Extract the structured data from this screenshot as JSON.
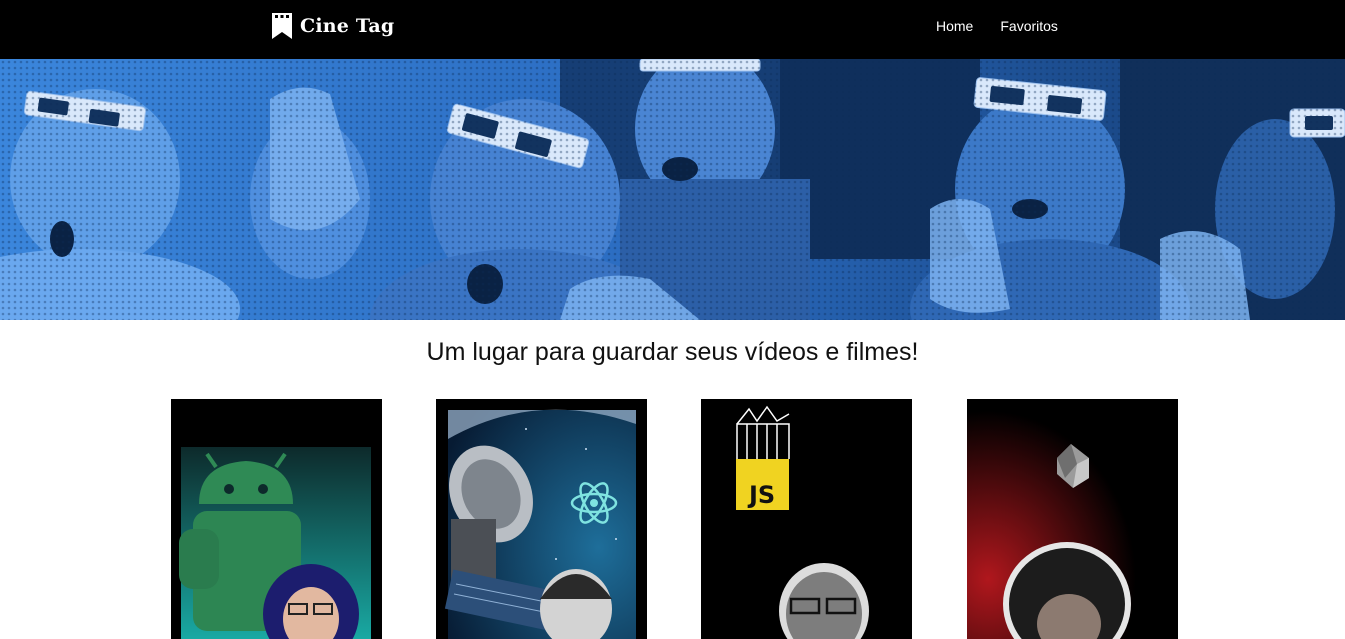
{
  "header": {
    "logo_text": "Cine Tag",
    "logo_icon": "film-bookmark-icon",
    "nav": [
      {
        "label": "Home"
      },
      {
        "label": "Favoritos"
      }
    ]
  },
  "banner": {
    "description_icon": "cinema-audience-3d-glasses-banner",
    "tint": "#2a73d1"
  },
  "main": {
    "title": "Um lugar para guardar seus vídeos e filmes!"
  },
  "cards": [
    {
      "icon": "android-thumbnail",
      "accent": "#17a6a0"
    },
    {
      "icon": "react-satellite-thumbnail",
      "accent": "#1b5f8c"
    },
    {
      "icon": "javascript-thumbnail",
      "accent": "#f0d321",
      "badge": "JS"
    },
    {
      "icon": "dart-thumbnail",
      "accent": "#b0171d"
    }
  ],
  "colors": {
    "header_bg": "#000000",
    "text": "#111111",
    "page_bg": "#ffffff"
  }
}
